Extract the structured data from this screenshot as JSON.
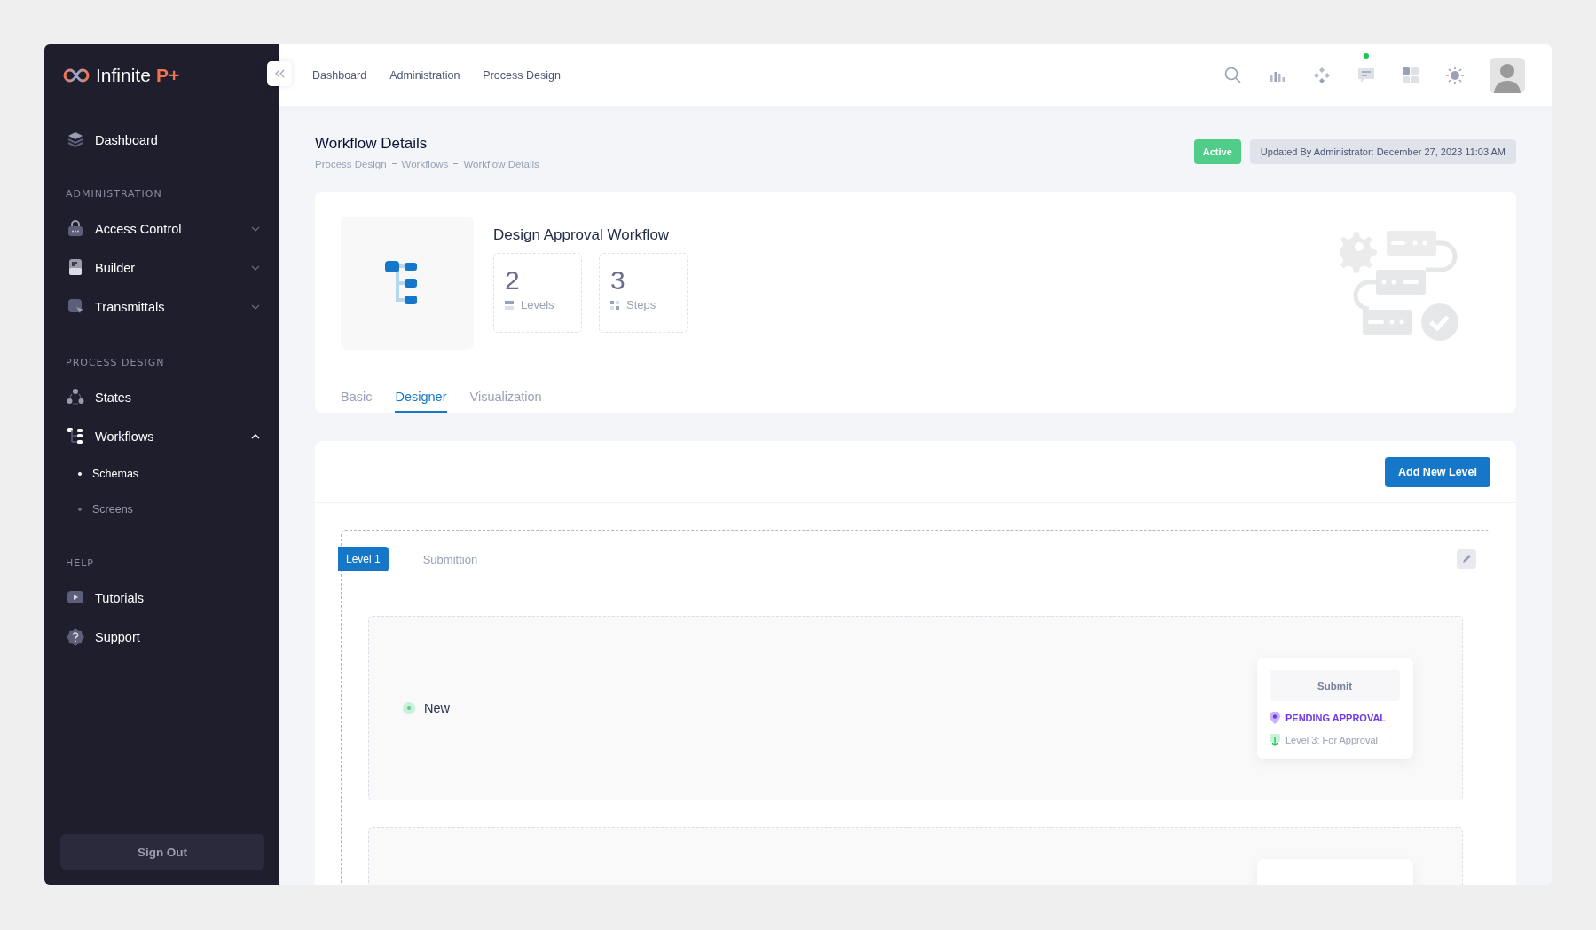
{
  "brand": {
    "name": "Infinite",
    "suffix": "P+"
  },
  "sidebar": {
    "sections": [
      {
        "items": [
          {
            "label": "Dashboard",
            "kind": "link"
          }
        ]
      },
      {
        "heading": "ADMINISTRATION",
        "items": [
          {
            "label": "Access Control",
            "kind": "group",
            "expanded": false
          },
          {
            "label": "Builder",
            "kind": "group",
            "expanded": false
          },
          {
            "label": "Transmittals",
            "kind": "group",
            "expanded": false
          }
        ]
      },
      {
        "heading": "PROCESS DESIGN",
        "items": [
          {
            "label": "States",
            "kind": "link"
          },
          {
            "label": "Workflows",
            "kind": "group",
            "expanded": true,
            "children": [
              {
                "label": "Schemas",
                "selected": true
              },
              {
                "label": "Screens",
                "selected": false
              }
            ]
          }
        ]
      },
      {
        "heading": "HELP",
        "items": [
          {
            "label": "Tutorials",
            "kind": "link"
          },
          {
            "label": "Support",
            "kind": "link"
          }
        ]
      }
    ],
    "sign_out": "Sign Out"
  },
  "topbar": {
    "links": [
      "Dashboard",
      "Administration",
      "Process Design"
    ],
    "notifications": true
  },
  "page": {
    "title": "Workflow Details",
    "breadcrumbs": [
      "Process Design",
      "Workflows",
      "Workflow Details"
    ],
    "status": "Active",
    "updated": "Updated By Administrator: December 27, 2023 11:03 AM"
  },
  "workflow": {
    "name": "Design Approval Workflow",
    "stats": [
      {
        "value": "2",
        "label": "Levels"
      },
      {
        "value": "3",
        "label": "Steps"
      }
    ],
    "tabs": [
      {
        "label": "Basic",
        "selected": false
      },
      {
        "label": "Designer",
        "selected": true
      },
      {
        "label": "Visualization",
        "selected": false
      }
    ]
  },
  "designer": {
    "add_button": "Add New Level",
    "levels": [
      {
        "badge": "Level 1",
        "name": "Submittion",
        "steps": [
          {
            "state": "New",
            "action": "Submit",
            "result": "PENDING APPROVAL",
            "target": "Level 3: For Approval"
          }
        ]
      }
    ]
  }
}
